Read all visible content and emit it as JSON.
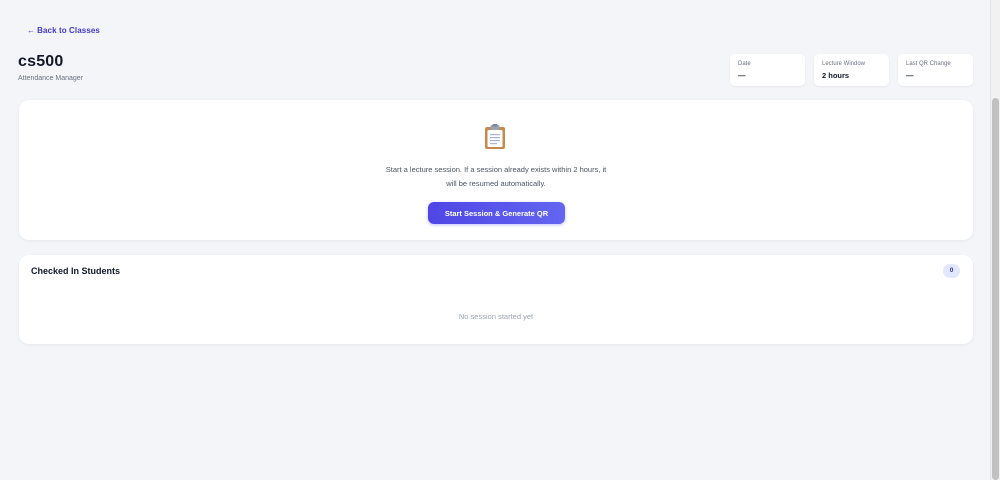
{
  "nav": {
    "back_arrow": "←",
    "back_label": "Back to Classes"
  },
  "header": {
    "class_name": "cs500",
    "subtitle": "Attendance Manager"
  },
  "stats": [
    {
      "label": "Date",
      "value": "—"
    },
    {
      "label": "Lecture Window",
      "value": "2 hours"
    },
    {
      "label": "Last QR Change",
      "value": "—"
    }
  ],
  "session": {
    "icon": "clipboard-icon",
    "message_line1": "Start a lecture session. If a session already exists within 2 hours, it",
    "message_line2": "will be resumed automatically.",
    "start_button_label": "Start Session & Generate QR"
  },
  "students": {
    "title": "Checked In Students",
    "count": "0",
    "empty_message": "No session started yet"
  },
  "colors": {
    "accent": "#4f46e5",
    "background": "#f3f5f9",
    "card": "#ffffff",
    "badge_bg": "#e0e7ff"
  }
}
